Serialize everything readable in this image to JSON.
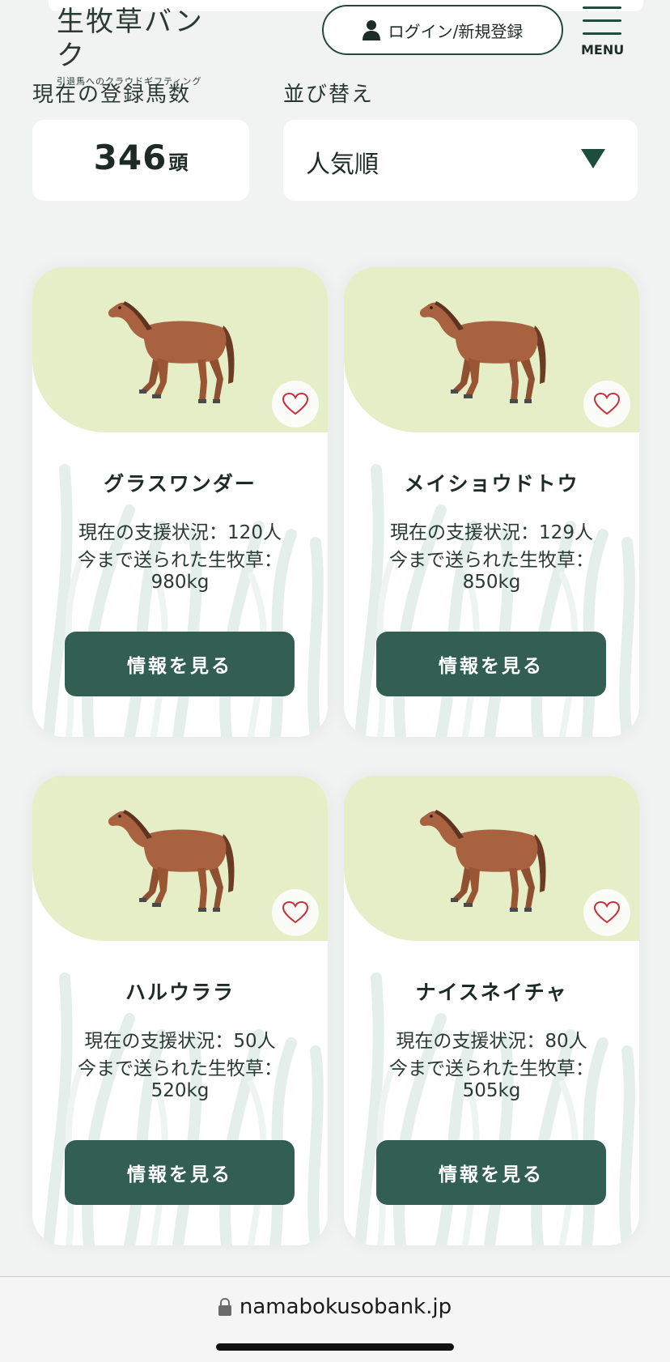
{
  "header": {
    "logo_title": "生牧草バンク",
    "logo_subtitle": "引退馬へのクラウドギフティング",
    "login_label": "ログイン/新規登録",
    "menu_label": "MENU"
  },
  "summary": {
    "count_label": "現在の登録馬数",
    "count_value": "346",
    "count_unit": "頭",
    "sort_label": "並び替え",
    "sort_value": "人気順"
  },
  "cards": [
    {
      "name": "グラスワンダー",
      "support": "現在の支援状況：120人",
      "grass_label": "今まで送られた生牧草：",
      "grass_value": "980kg",
      "button": "情報を見る"
    },
    {
      "name": "メイショウドトウ",
      "support": "現在の支援状況：129人",
      "grass_label": "今まで送られた生牧草：",
      "grass_value": "850kg",
      "button": "情報を見る"
    },
    {
      "name": "ハルウララ",
      "support": "現在の支援状況：50人",
      "grass_label": "今まで送られた生牧草：",
      "grass_value": "520kg",
      "button": "情報を見る"
    },
    {
      "name": "ナイスネイチャ",
      "support": "現在の支援状況：80人",
      "grass_label": "今まで送られた生牧草：",
      "grass_value": "505kg",
      "button": "情報を見る"
    }
  ],
  "browser": {
    "url": "namabokusobank.jp"
  },
  "colors": {
    "accent": "#335f52",
    "image_bg": "#e6eec8",
    "heart": "#c8323c"
  },
  "icons": [
    "user-icon",
    "menu-icon",
    "dropdown-arrow-icon",
    "horse-icon",
    "heart-icon",
    "lock-icon"
  ]
}
